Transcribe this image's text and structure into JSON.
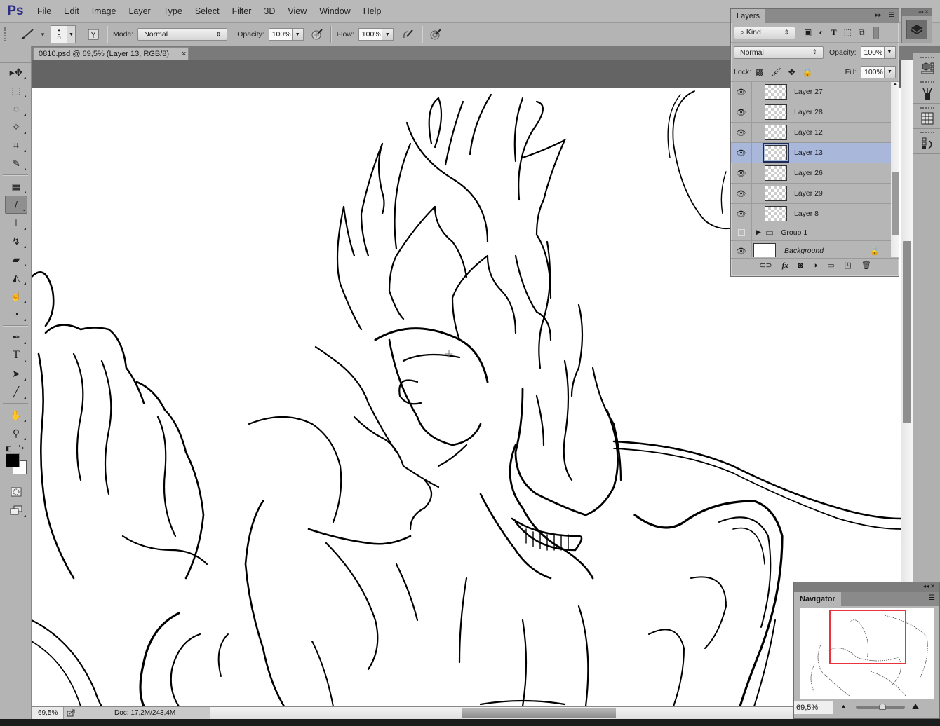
{
  "app": {
    "logo": "Ps"
  },
  "menu": [
    "File",
    "Edit",
    "Image",
    "Layer",
    "Type",
    "Select",
    "Filter",
    "3D",
    "View",
    "Window",
    "Help"
  ],
  "options_bar": {
    "tool_icon": "brush-icon",
    "brush_size": "5",
    "mode_label": "Mode:",
    "mode_value": "Normal",
    "opacity_label": "Opacity:",
    "opacity_value": "100%",
    "flow_label": "Flow:",
    "flow_value": "100%"
  },
  "document": {
    "tab_title": "0810.psd @ 69,5% (Layer 13, RGB/8)",
    "close_glyph": "×"
  },
  "tools": [
    {
      "name": "move-tool",
      "glyph": "▸✥"
    },
    {
      "name": "marquee-tool",
      "glyph": "⬚"
    },
    {
      "name": "lasso-tool",
      "glyph": "◌"
    },
    {
      "name": "magic-wand-tool",
      "glyph": "✧"
    },
    {
      "name": "crop-tool",
      "glyph": "⌗"
    },
    {
      "name": "eyedropper-tool",
      "glyph": "✎"
    },
    {
      "name": "spot-healing-tool",
      "glyph": "▦"
    },
    {
      "name": "brush-tool",
      "glyph": "/",
      "active": true
    },
    {
      "name": "clone-stamp-tool",
      "glyph": "⊥"
    },
    {
      "name": "history-brush-tool",
      "glyph": "↯"
    },
    {
      "name": "eraser-tool",
      "glyph": "▰"
    },
    {
      "name": "paint-bucket-tool",
      "glyph": "◭"
    },
    {
      "name": "blur-tool",
      "glyph": "☝"
    },
    {
      "name": "dodge-tool",
      "glyph": "◔"
    },
    {
      "name": "pen-tool",
      "glyph": "✒"
    },
    {
      "name": "type-tool",
      "glyph": "T"
    },
    {
      "name": "path-selection-tool",
      "glyph": "➤"
    },
    {
      "name": "line-tool",
      "glyph": "╱"
    },
    {
      "name": "hand-tool",
      "glyph": "✋"
    },
    {
      "name": "zoom-tool",
      "glyph": "⚲"
    }
  ],
  "colors": {
    "foreground": "#000000",
    "background": "#ffffff",
    "selection_highlight": "#a9b7da",
    "navigator_box": "#e8343c"
  },
  "layers_panel": {
    "tab_label": "Layers",
    "filter_label": "Kind",
    "blend_mode": "Normal",
    "opacity_label": "Opacity:",
    "opacity_value": "100%",
    "lock_label": "Lock:",
    "fill_label": "Fill:",
    "fill_value": "100%",
    "layers": [
      {
        "name": "Layer 27",
        "visible": true
      },
      {
        "name": "Layer 28",
        "visible": true
      },
      {
        "name": "Layer 12",
        "visible": true
      },
      {
        "name": "Layer 13",
        "visible": true,
        "selected": true
      },
      {
        "name": "Layer 26",
        "visible": true
      },
      {
        "name": "Layer 29",
        "visible": true
      },
      {
        "name": "Layer 8",
        "visible": true
      },
      {
        "name": "Group 1",
        "visible": false,
        "type": "group"
      },
      {
        "name": "Background",
        "visible": true,
        "type": "background",
        "locked": true
      }
    ]
  },
  "navigator": {
    "tab_label": "Navigator",
    "zoom": "69,5%"
  },
  "status": {
    "zoom": "69,5%",
    "doc_info": "Doc: 17,2M/243,4M"
  }
}
